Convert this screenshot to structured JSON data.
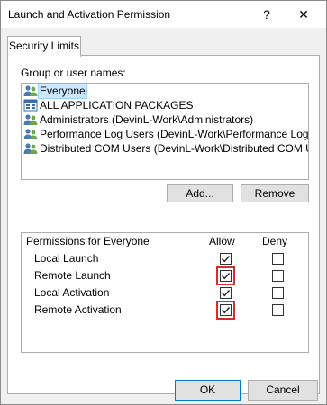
{
  "window": {
    "title": "Launch and Activation Permission",
    "help_glyph": "?",
    "close_glyph": "✕"
  },
  "tabs": [
    {
      "label": "Security Limits"
    }
  ],
  "users": {
    "label": "Group or user names:",
    "items": [
      {
        "name": "Everyone",
        "icon": "group-icon",
        "selected": true
      },
      {
        "name": "ALL APPLICATION PACKAGES",
        "icon": "app-packages-icon",
        "selected": false
      },
      {
        "name": "Administrators (DevinL-Work\\Administrators)",
        "icon": "group-icon",
        "selected": false
      },
      {
        "name": "Performance Log Users (DevinL-Work\\Performance Log Us...",
        "icon": "group-icon",
        "selected": false
      },
      {
        "name": "Distributed COM Users (DevinL-Work\\Distributed COM Users)",
        "icon": "group-icon",
        "selected": false
      }
    ]
  },
  "buttons": {
    "add": "Add...",
    "remove": "Remove",
    "ok": "OK",
    "cancel": "Cancel"
  },
  "permissions": {
    "header": "Permissions for Everyone",
    "allow_header": "Allow",
    "deny_header": "Deny",
    "rows": [
      {
        "label": "Local Launch",
        "allow": true,
        "deny": false,
        "highlight": false
      },
      {
        "label": "Remote Launch",
        "allow": true,
        "deny": false,
        "highlight": true
      },
      {
        "label": "Local Activation",
        "allow": true,
        "deny": false,
        "highlight": false
      },
      {
        "label": "Remote Activation",
        "allow": true,
        "deny": false,
        "highlight": true
      }
    ]
  },
  "colors": {
    "highlight": "#d32f2f",
    "selection": "#cce8ff",
    "group_icon_primary": "#4a7ab0",
    "group_icon_secondary": "#6aa84f"
  }
}
